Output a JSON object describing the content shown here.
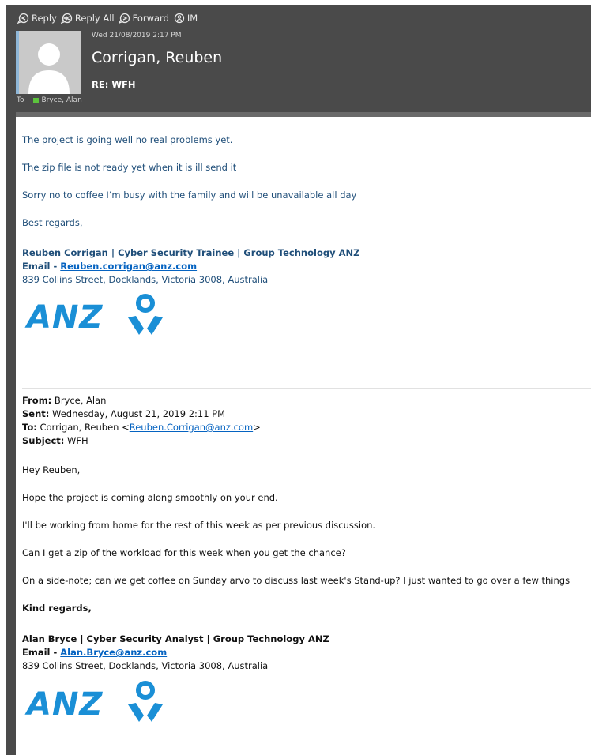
{
  "toolbar": {
    "reply": "Reply",
    "reply_all": "Reply All",
    "forward": "Forward",
    "im": "IM"
  },
  "header": {
    "date": "Wed 21/08/2019 2:17 PM",
    "sender": "Corrigan, Reuben",
    "subject": "RE: WFH",
    "to_label": "To",
    "to_name": "Bryce, Alan",
    "presence_color": "#5cc33d"
  },
  "reply": {
    "line1": "The project is going well no real problems yet.",
    "line2": "The zip file is not ready yet when it is ill send it",
    "line3": "Sorry no to coffee I’m busy with the family and will be unavailable all day",
    "closing": "Best regards,",
    "sig_name": "Reuben Corrigan | Cyber Security Trainee | Group Technology ANZ",
    "sig_email_label": "Email - ",
    "sig_email": "Reuben.corrigan@anz.com",
    "sig_address": "839 Collins Street, Docklands, Victoria 3008, Australia",
    "logo_text": "ANZ"
  },
  "original": {
    "from_label": "From:",
    "from": " Bryce, Alan",
    "sent_label": "Sent:",
    "sent": " Wednesday, August 21, 2019 2:11 PM",
    "to_label": "To:",
    "to_name": " Corrigan, Reuben <",
    "to_email": "Reuben.Corrigan@anz.com",
    "to_close": ">",
    "subject_label": "Subject:",
    "subject": " WFH",
    "greeting": "Hey Reuben,",
    "line1": "Hope the project is coming along smoothly on your end.",
    "line2": "I'll be working from home for the rest of this week as per previous discussion.",
    "line3": "Can I get a zip of the workload for this week when you get the chance?",
    "line4": "On a side-note; can we get coffee on Sunday arvo to discuss last week's Stand-up? I just wanted to go over a few things",
    "closing": "Kind regards,",
    "sig_name": "Alan Bryce | Cyber Security Analyst | Group Technology ANZ",
    "sig_email_label": "Email - ",
    "sig_email": "Alan.Bryce@anz.com",
    "sig_address": "839 Collins Street, Docklands, Victoria 3008, Australia",
    "logo_text": "ANZ"
  },
  "colors": {
    "header_bg": "#4a4a4a",
    "reply_text": "#1f4e79",
    "link": "#0563c1",
    "anz_blue": "#1a8fd6"
  }
}
